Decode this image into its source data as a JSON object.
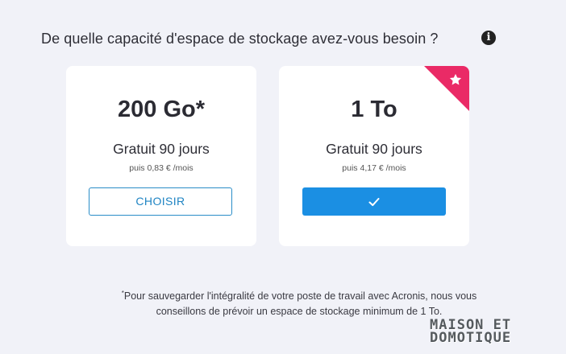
{
  "question": "De quelle capacité d'espace de stockage avez-vous besoin ?",
  "info_icon": "info-icon",
  "plans": [
    {
      "capacity": "200 Go*",
      "trial": "Gratuit 90 jours",
      "price": "puis 0,83 € /mois",
      "button_label": "CHOISIR",
      "selected": false
    },
    {
      "capacity": "1 To",
      "trial": "Gratuit 90 jours",
      "price": "puis 4,17 € /mois",
      "button_icon": "checkmark-icon",
      "selected": true,
      "ribbon_icon": "star-icon"
    }
  ],
  "footnote": {
    "marker": "*",
    "line1": "Pour sauvegarder l'intégralité de votre poste de travail avec Acronis, nous vous",
    "line2": "conseillons de prévoir un espace de stockage minimum de 1 To."
  },
  "watermark": {
    "line1": "MAISON ET",
    "line2": "DOMOTIQUE"
  },
  "colors": {
    "background": "#f1f2f8",
    "accent": "#1b8fe3",
    "ribbon": "#ea2a66",
    "outline": "#2a8dc8"
  }
}
